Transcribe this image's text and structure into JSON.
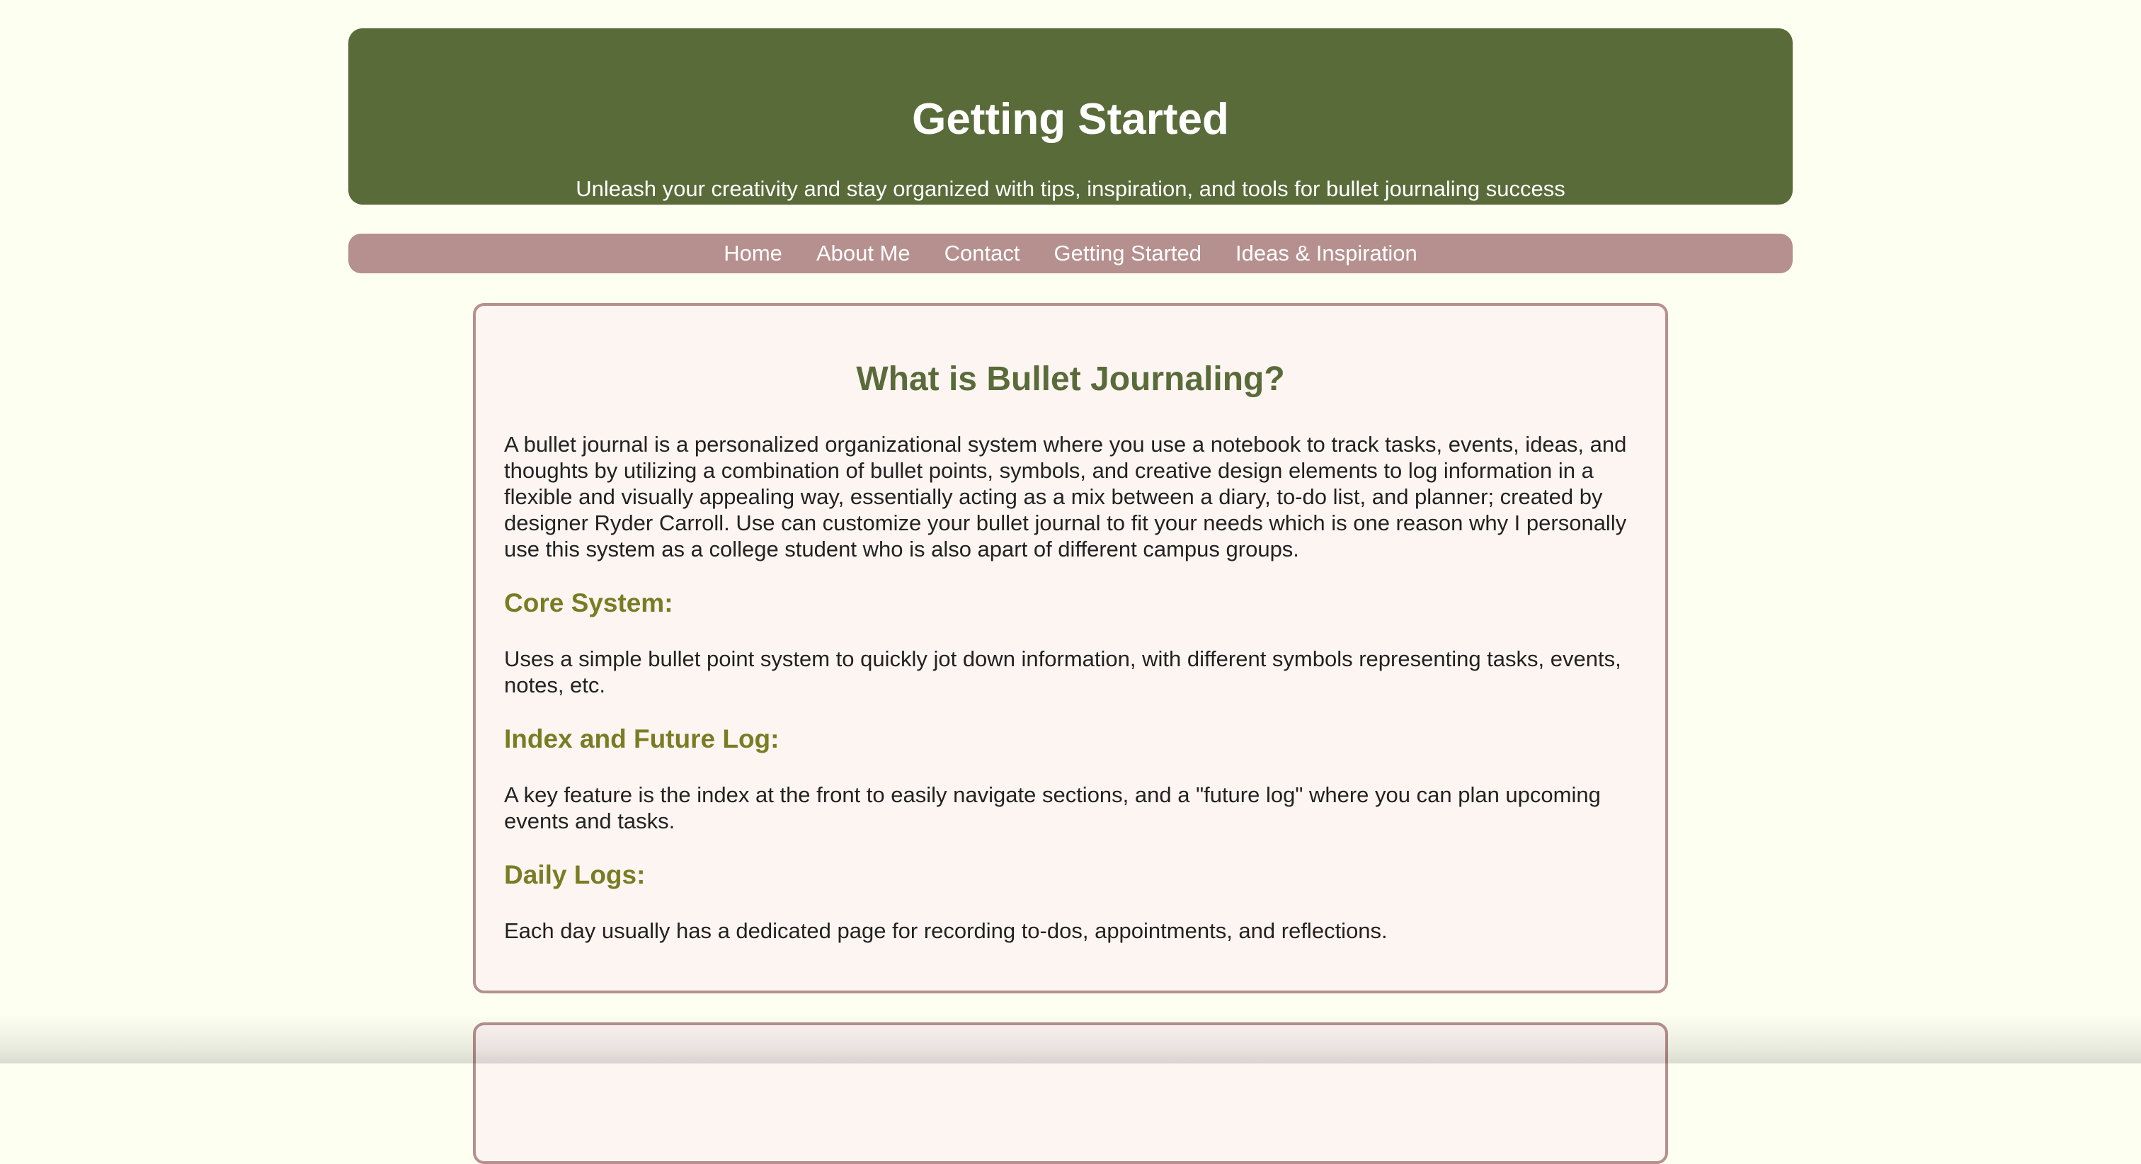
{
  "header": {
    "title": "Getting Started",
    "tagline": "Unleash your creativity and stay organized with tips, inspiration, and tools for bullet journaling success"
  },
  "nav": {
    "items": [
      {
        "label": "Home"
      },
      {
        "label": "About Me"
      },
      {
        "label": "Contact"
      },
      {
        "label": "Getting Started"
      },
      {
        "label": "Ideas & Inspiration"
      }
    ]
  },
  "main": {
    "section_title": "What is Bullet Journaling?",
    "intro": "A bullet journal is a personalized organizational system where you use a notebook to track tasks, events, ideas, and thoughts by utilizing a combination of bullet points, symbols, and creative design elements to log information in a flexible and visually appealing way, essentially acting as a mix between a diary, to-do list, and planner; created by designer Ryder Carroll. Use can customize your bullet journal to fit your needs which is one reason why I personally use this system as a college student who is also apart of different campus groups.",
    "subsections": [
      {
        "heading": "Core System:",
        "text": "Uses a simple bullet point system to quickly jot down information, with different symbols representing tasks, events, notes, etc."
      },
      {
        "heading": "Index and Future Log:",
        "text": "A key feature is the index at the front to easily navigate sections, and a \"future log\" where you can plan upcoming events and tasks."
      },
      {
        "heading": "Daily Logs:",
        "text": "Each day usually has a dedicated page for recording to-dos, appointments, and reflections."
      }
    ]
  },
  "colors": {
    "page_background": "#fdfff1",
    "header_background": "#5a6b3a",
    "nav_background": "#b5908e",
    "card_background": "#fdf5f2",
    "card_border": "#b5908e",
    "section_title": "#5a6b3a",
    "subheading": "#7a7c24"
  }
}
